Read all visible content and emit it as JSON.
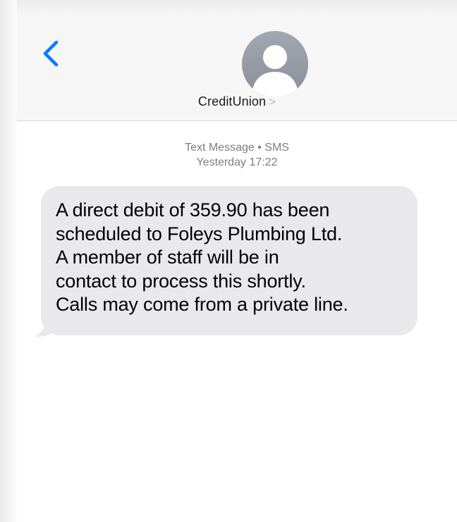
{
  "header": {
    "back_icon": "chevron-left-icon",
    "avatar_icon": "person-silhouette-icon",
    "contact_name": "CreditUnion",
    "contact_chevron": ">"
  },
  "thread": {
    "meta_line1": "Text Message • SMS",
    "meta_line2": "Yesterday 17:22"
  },
  "messages": [
    {
      "direction": "incoming",
      "lines": [
        "A direct debit of 359.90 has been",
        "scheduled to Foleys Plumbing Ltd.",
        "A member of staff will be in",
        "contact to process this shortly.",
        "Calls may come from a private line."
      ]
    }
  ],
  "colors": {
    "accent": "#0a7aff",
    "header_bg": "#f6f6f7",
    "bubble_bg": "#e9e9eb",
    "meta_text": "#7d7d83",
    "avatar": "#8e929c"
  }
}
